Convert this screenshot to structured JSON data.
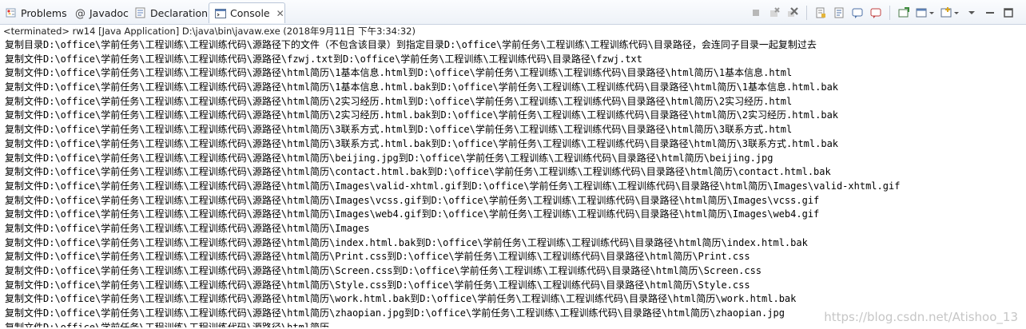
{
  "tabs": [
    {
      "label": "Problems",
      "icon": "problems-icon"
    },
    {
      "label": "Javadoc",
      "icon": "at-icon"
    },
    {
      "label": "Declaration",
      "icon": "declaration-icon"
    },
    {
      "label": "Console",
      "icon": "console-icon",
      "active": true,
      "close": "✕"
    }
  ],
  "status": "<terminated> rw14 [Java Application] D:\\java\\bin\\javaw.exe (2018年9月11日 下午3:34:32)",
  "console_lines": [
    "复制目录D:\\office\\学前任务\\工程训练\\工程训练代码\\源路径下的文件（不包含该目录）到指定目录D:\\office\\学前任务\\工程训练\\工程训练代码\\目录路径，会连同子目录一起复制过去",
    "复制文件D:\\office\\学前任务\\工程训练\\工程训练代码\\源路径\\fzwj.txt到D:\\office\\学前任务\\工程训练\\工程训练代码\\目录路径\\fzwj.txt",
    "复制文件D:\\office\\学前任务\\工程训练\\工程训练代码\\源路径\\html简历\\1基本信息.html到D:\\office\\学前任务\\工程训练\\工程训练代码\\目录路径\\html简历\\1基本信息.html",
    "复制文件D:\\office\\学前任务\\工程训练\\工程训练代码\\源路径\\html简历\\1基本信息.html.bak到D:\\office\\学前任务\\工程训练\\工程训练代码\\目录路径\\html简历\\1基本信息.html.bak",
    "复制文件D:\\office\\学前任务\\工程训练\\工程训练代码\\源路径\\html简历\\2实习经历.html到D:\\office\\学前任务\\工程训练\\工程训练代码\\目录路径\\html简历\\2实习经历.html",
    "复制文件D:\\office\\学前任务\\工程训练\\工程训练代码\\源路径\\html简历\\2实习经历.html.bak到D:\\office\\学前任务\\工程训练\\工程训练代码\\目录路径\\html简历\\2实习经历.html.bak",
    "复制文件D:\\office\\学前任务\\工程训练\\工程训练代码\\源路径\\html简历\\3联系方式.html到D:\\office\\学前任务\\工程训练\\工程训练代码\\目录路径\\html简历\\3联系方式.html",
    "复制文件D:\\office\\学前任务\\工程训练\\工程训练代码\\源路径\\html简历\\3联系方式.html.bak到D:\\office\\学前任务\\工程训练\\工程训练代码\\目录路径\\html简历\\3联系方式.html.bak",
    "复制文件D:\\office\\学前任务\\工程训练\\工程训练代码\\源路径\\html简历\\beijing.jpg到D:\\office\\学前任务\\工程训练\\工程训练代码\\目录路径\\html简历\\beijing.jpg",
    "复制文件D:\\office\\学前任务\\工程训练\\工程训练代码\\源路径\\html简历\\contact.html.bak到D:\\office\\学前任务\\工程训练\\工程训练代码\\目录路径\\html简历\\contact.html.bak",
    "复制文件D:\\office\\学前任务\\工程训练\\工程训练代码\\源路径\\html简历\\Images\\valid-xhtml.gif到D:\\office\\学前任务\\工程训练\\工程训练代码\\目录路径\\html简历\\Images\\valid-xhtml.gif",
    "复制文件D:\\office\\学前任务\\工程训练\\工程训练代码\\源路径\\html简历\\Images\\vcss.gif到D:\\office\\学前任务\\工程训练\\工程训练代码\\目录路径\\html简历\\Images\\vcss.gif",
    "复制文件D:\\office\\学前任务\\工程训练\\工程训练代码\\源路径\\html简历\\Images\\web4.gif到D:\\office\\学前任务\\工程训练\\工程训练代码\\目录路径\\html简历\\Images\\web4.gif",
    "复制文件D:\\office\\学前任务\\工程训练\\工程训练代码\\源路径\\html简历\\Images",
    "复制文件D:\\office\\学前任务\\工程训练\\工程训练代码\\源路径\\html简历\\index.html.bak到D:\\office\\学前任务\\工程训练\\工程训练代码\\目录路径\\html简历\\index.html.bak",
    "复制文件D:\\office\\学前任务\\工程训练\\工程训练代码\\源路径\\html简历\\Print.css到D:\\office\\学前任务\\工程训练\\工程训练代码\\目录路径\\html简历\\Print.css",
    "复制文件D:\\office\\学前任务\\工程训练\\工程训练代码\\源路径\\html简历\\Screen.css到D:\\office\\学前任务\\工程训练\\工程训练代码\\目录路径\\html简历\\Screen.css",
    "复制文件D:\\office\\学前任务\\工程训练\\工程训练代码\\源路径\\html简历\\Style.css到D:\\office\\学前任务\\工程训练\\工程训练代码\\目录路径\\html简历\\Style.css",
    "复制文件D:\\office\\学前任务\\工程训练\\工程训练代码\\源路径\\html简历\\work.html.bak到D:\\office\\学前任务\\工程训练\\工程训练代码\\目录路径\\html简历\\work.html.bak",
    "复制文件D:\\office\\学前任务\\工程训练\\工程训练代码\\源路径\\html简历\\zhaopian.jpg到D:\\office\\学前任务\\工程训练\\工程训练代码\\目录路径\\html简历\\zhaopian.jpg",
    "复制文件D:\\office\\学前任务\\工程训练\\工程训练代码\\源路径\\html简历"
  ],
  "watermark": "https://blog.csdn.net/Atishoo_13",
  "toolbar_icons": [
    "terminate-icon",
    "remove-launch-icon",
    "remove-all-terminated-icon",
    "scroll-lock-icon",
    "word-wrap-icon",
    "show-on-stdout-icon",
    "show-on-stderr-icon",
    "pin-console-icon",
    "display-selected-console-icon",
    "open-console-icon",
    "view-menu-icon"
  ],
  "colors": {
    "console_text": "#000000",
    "tab_active_bg": "#ffffff",
    "tabbar_bg": "#eef2f8",
    "watermark": "#c6c6c6"
  }
}
